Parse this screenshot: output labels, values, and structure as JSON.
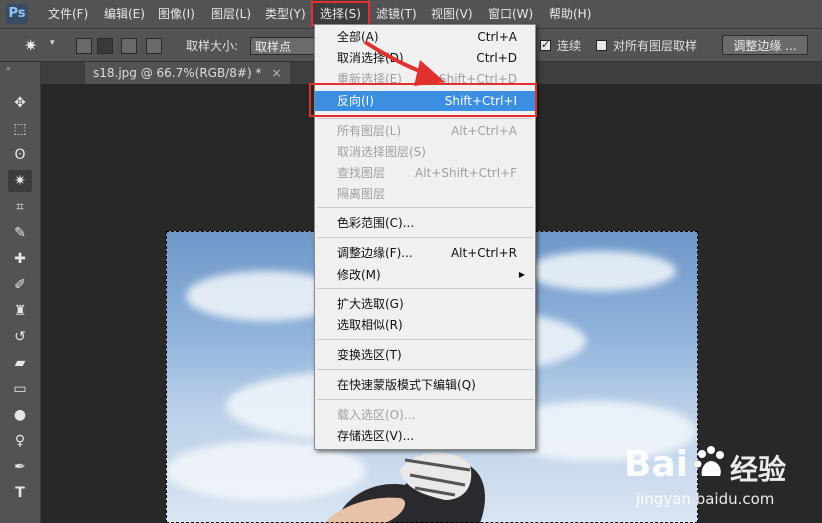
{
  "app": {
    "logo": "Ps"
  },
  "menubar": {
    "items": [
      {
        "label": "文件(F)"
      },
      {
        "label": "编辑(E)"
      },
      {
        "label": "图像(I)"
      },
      {
        "label": "图层(L)"
      },
      {
        "label": "类型(Y)"
      },
      {
        "label": "选择(S)"
      },
      {
        "label": "滤镜(T)"
      },
      {
        "label": "视图(V)"
      },
      {
        "label": "窗口(W)"
      },
      {
        "label": "帮助(H)"
      }
    ]
  },
  "options": {
    "sample_size_label": "取样大小:",
    "sample_size_value": "取样点",
    "contiguous_label": "连续",
    "all_layers_label": "对所有图层取样",
    "refine_edge_button": "调整边缘 ..."
  },
  "document": {
    "tab_title": "s18.jpg @ 66.7%(RGB/8#) *",
    "close": "×"
  },
  "select_menu": {
    "items": [
      {
        "label": "全部(A)",
        "shortcut": "Ctrl+A"
      },
      {
        "label": "取消选择(D)",
        "shortcut": "Ctrl+D"
      },
      {
        "label": "重新选择(E)",
        "shortcut": "Shift+Ctrl+D"
      },
      {
        "label": "反向(I)",
        "shortcut": "Shift+Ctrl+I"
      },
      {
        "label": "所有图层(L)",
        "shortcut": "Alt+Ctrl+A"
      },
      {
        "label": "取消选择图层(S)",
        "shortcut": ""
      },
      {
        "label": "查找图层",
        "shortcut": "Alt+Shift+Ctrl+F"
      },
      {
        "label": "隔离图层",
        "shortcut": ""
      },
      {
        "label": "色彩范围(C)...",
        "shortcut": ""
      },
      {
        "label": "调整边缘(F)...",
        "shortcut": "Alt+Ctrl+R"
      },
      {
        "label": "修改(M)",
        "shortcut": ""
      },
      {
        "label": "扩大选取(G)",
        "shortcut": ""
      },
      {
        "label": "选取相似(R)",
        "shortcut": ""
      },
      {
        "label": "变换选区(T)",
        "shortcut": ""
      },
      {
        "label": "在快速蒙版模式下编辑(Q)",
        "shortcut": ""
      },
      {
        "label": "载入选区(O)...",
        "shortcut": ""
      },
      {
        "label": "存储选区(V)...",
        "shortcut": ""
      }
    ]
  },
  "watermark": {
    "brand": "Bai",
    "brand_cn": "经验",
    "url": "jingyan.baidu.com"
  },
  "colors": {
    "highlight": "#3c8fe0",
    "annotation_red": "#e0312f",
    "ui_gray": "#535353"
  }
}
